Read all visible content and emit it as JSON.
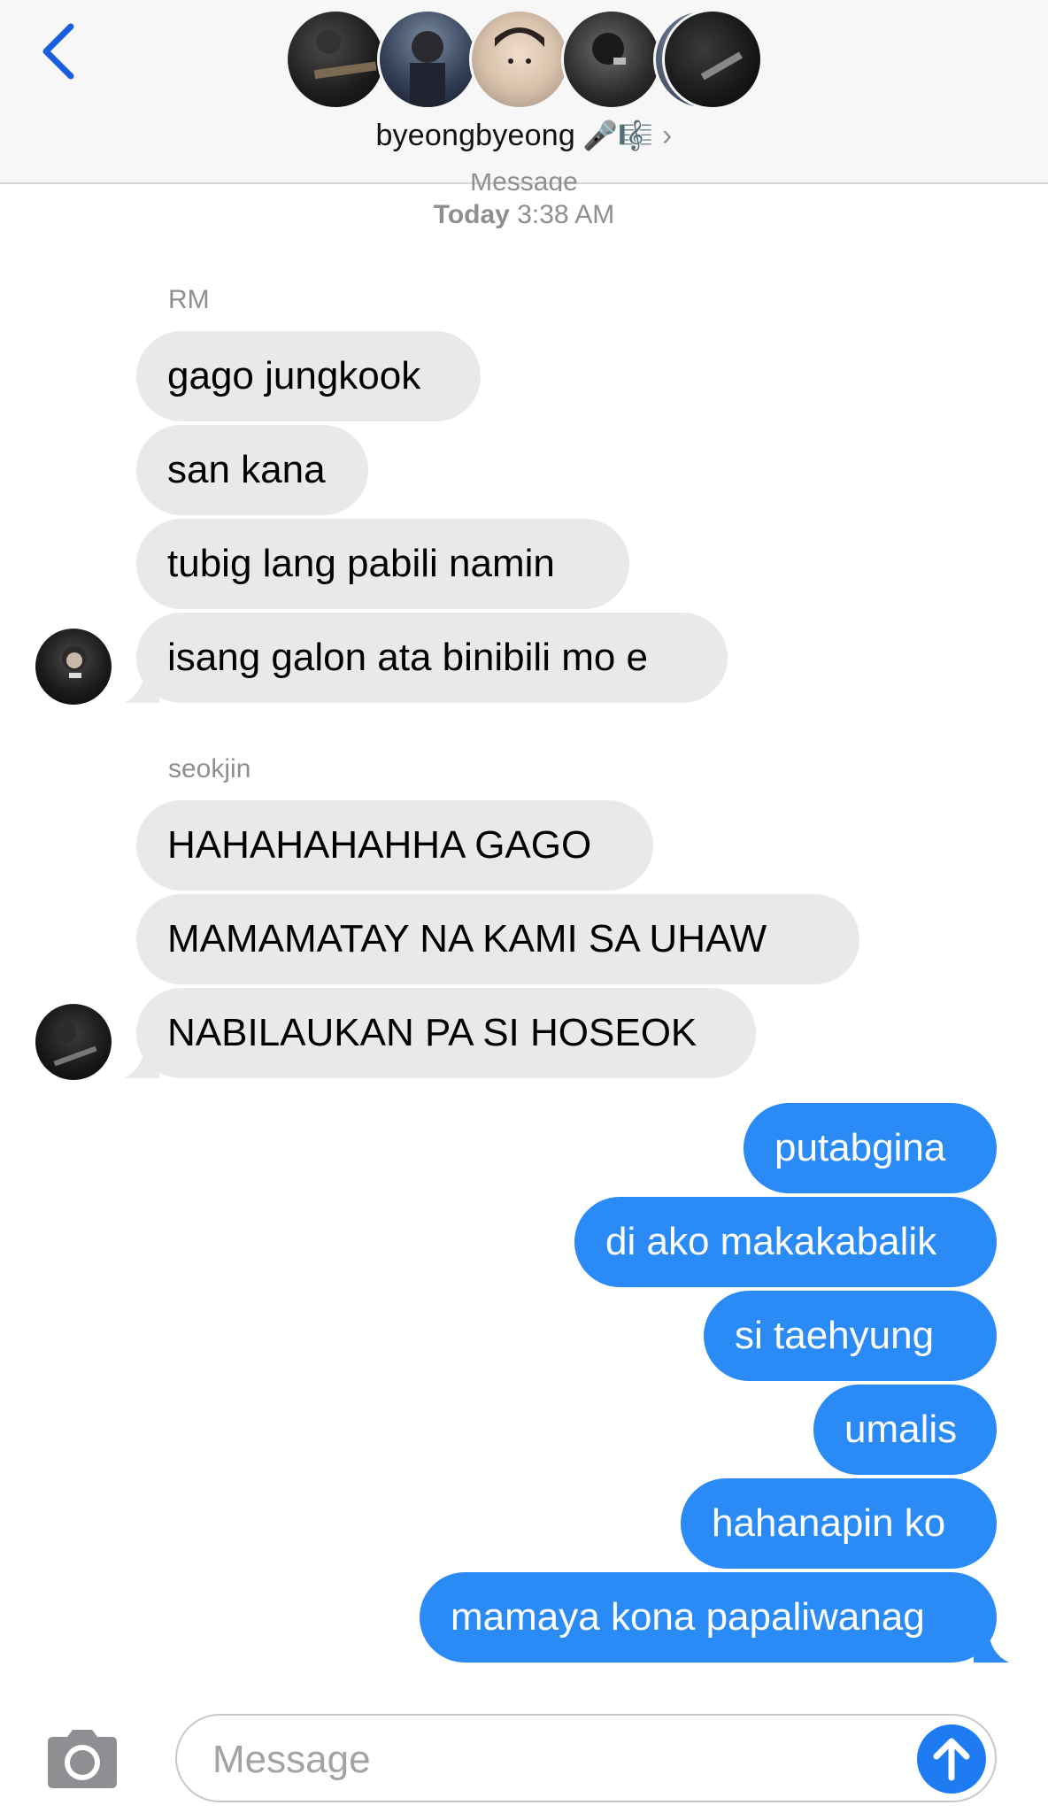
{
  "header": {
    "group_name": "byeongbyeong",
    "group_emojis": "🎤🎼",
    "participant_count_avatars": 6
  },
  "thread": {
    "peek_text": "Message",
    "timestamp_day": "Today",
    "timestamp_time": "3:38 AM"
  },
  "groups": [
    {
      "sender": "RM",
      "messages": [
        "gago jungkook",
        "san kana",
        "tubig lang pabili namin",
        "isang galon ata binibili mo e"
      ]
    },
    {
      "sender": "seokjin",
      "messages": [
        "HAHAHAHAHHA GAGO",
        "MAMAMATAY NA KAMI SA UHAW",
        "NABILAUKAN PA SI HOSEOK"
      ]
    }
  ],
  "outgoing": [
    "putabgina",
    "di ako makakabalik",
    "si taehyung",
    "umalis",
    "hahanapin ko",
    "mamaya kona papaliwanag"
  ],
  "input": {
    "placeholder": "Message"
  },
  "colors": {
    "incoming_bubble": "#e9e9eb",
    "outgoing_bubble": "#2a8af6",
    "accent": "#1f7bf2",
    "secondary_text": "#8e8e93"
  }
}
